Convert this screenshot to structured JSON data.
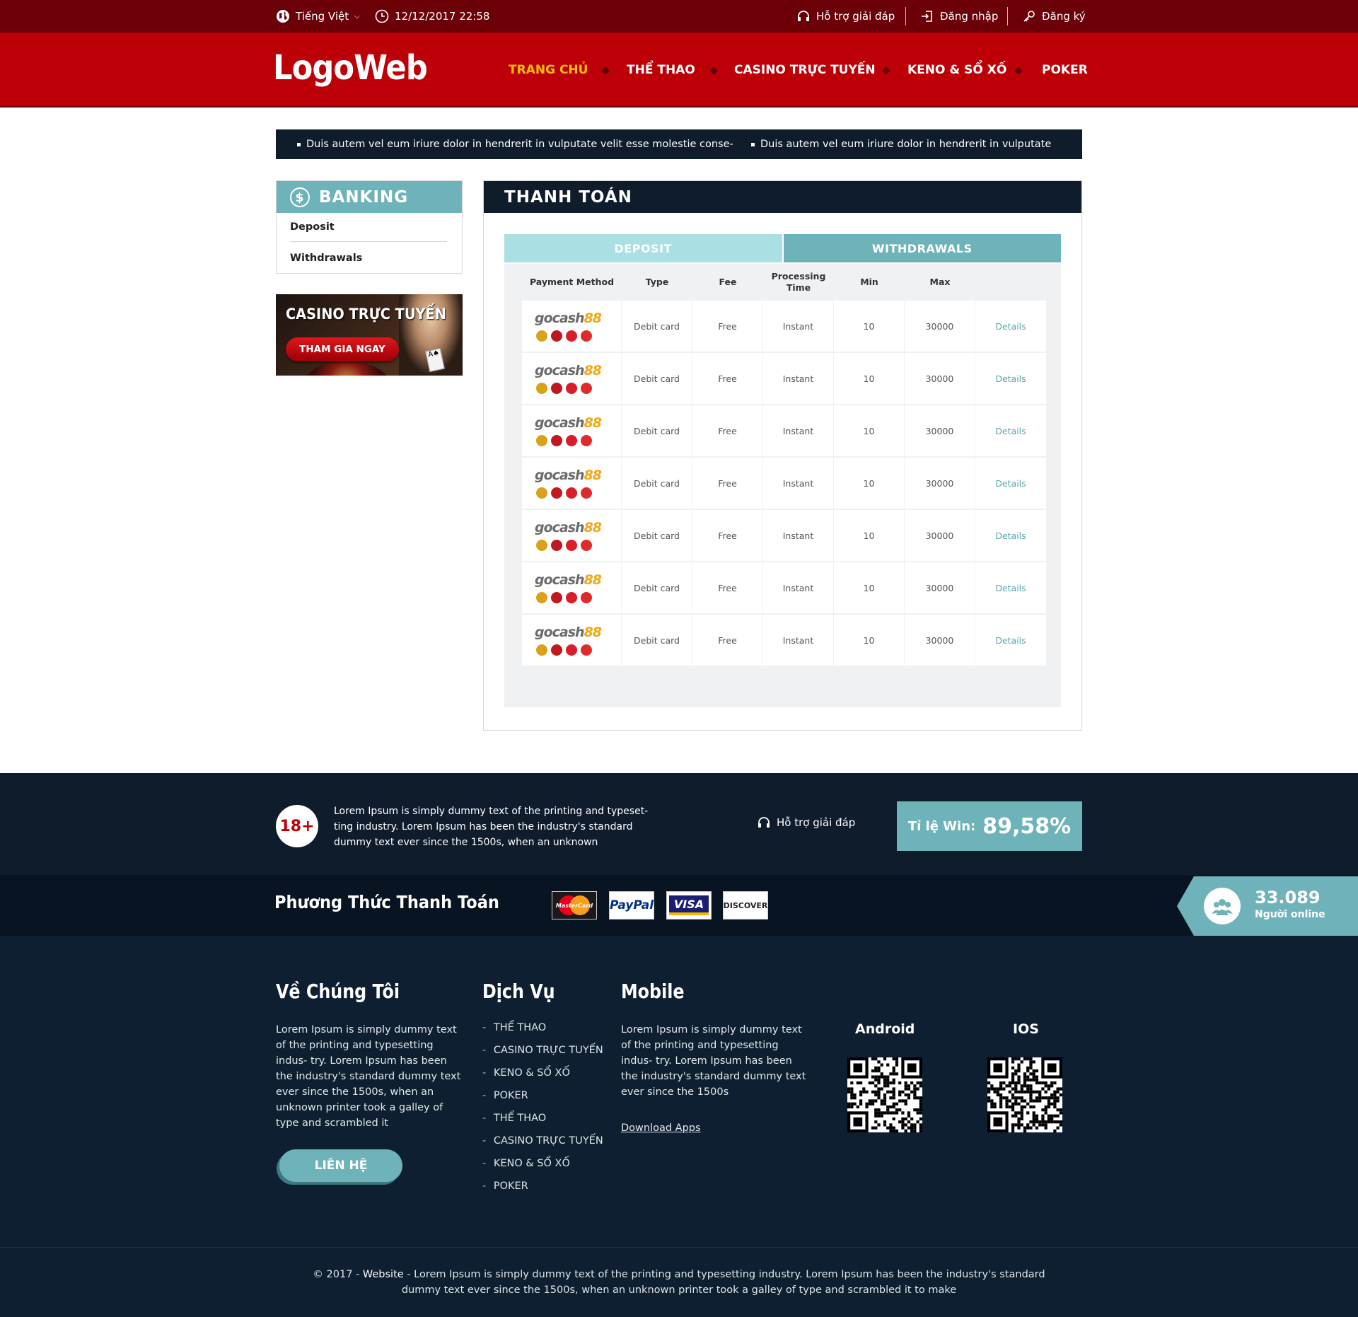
{
  "topbar": {
    "language": "Tiếng Việt",
    "datetime": "12/12/2017 22:58",
    "support": "Hỗ trợ giải đáp",
    "login": "Đăng nhập",
    "register": "Đăng ký"
  },
  "header": {
    "logo": "LogoWeb",
    "nav": [
      "TRANG CHỦ",
      "THỂ THAO",
      "CASINO TRỰC TUYẾN",
      "KENO & SỔ XỐ",
      "POKER"
    ]
  },
  "ticker": [
    "Duis autem vel eum iriure dolor in hendrerit in vulputate velit esse molestie conse-",
    "Duis autem vel eum iriure dolor in hendrerit in vulputate"
  ],
  "sidebar": {
    "title": "BANKING",
    "items": [
      "Deposit",
      "Withdrawals"
    ],
    "banner_title": "CASINO TRỰC TUYẾN",
    "banner_button": "THAM GIA NGAY"
  },
  "main": {
    "title": "THANH TOÁN",
    "tabs": [
      "DEPOSIT",
      "WITHDRAWALS"
    ],
    "columns": [
      "Payment Method",
      "Type",
      "Fee",
      "Processing Time",
      "Min",
      "Max"
    ],
    "rows": [
      {
        "method": "gocash88",
        "type": "Debit card",
        "fee": "Free",
        "time": "Instant",
        "min": "10",
        "max": "30000",
        "action": "Details"
      },
      {
        "method": "gocash88",
        "type": "Debit card",
        "fee": "Free",
        "time": "Instant",
        "min": "10",
        "max": "30000",
        "action": "Details"
      },
      {
        "method": "gocash88",
        "type": "Debit card",
        "fee": "Free",
        "time": "Instant",
        "min": "10",
        "max": "30000",
        "action": "Details"
      },
      {
        "method": "gocash88",
        "type": "Debit card",
        "fee": "Free",
        "time": "Instant",
        "min": "10",
        "max": "30000",
        "action": "Details"
      },
      {
        "method": "gocash88",
        "type": "Debit card",
        "fee": "Free",
        "time": "Instant",
        "min": "10",
        "max": "30000",
        "action": "Details"
      },
      {
        "method": "gocash88",
        "type": "Debit card",
        "fee": "Free",
        "time": "Instant",
        "min": "10",
        "max": "30000",
        "action": "Details"
      },
      {
        "method": "gocash88",
        "type": "Debit card",
        "fee": "Free",
        "time": "Instant",
        "min": "10",
        "max": "30000",
        "action": "Details"
      }
    ]
  },
  "footer_top": {
    "age": "18+",
    "text": "Lorem Ipsum is simply dummy text of the printing and typeset- ting industry. Lorem Ipsum has been the industry's standard dummy text ever since the 1500s, when an unknown",
    "support": "Hỗ trợ giải đáp",
    "win_label": "Tỉ lệ Win:",
    "win_value": "89,58%"
  },
  "payments": {
    "title": "Phương Thức Thanh Toán",
    "logos": [
      "MasterCard",
      "PayPal",
      "VISA",
      "DISCOVER"
    ],
    "online_count": "33.089",
    "online_label": "Người online"
  },
  "footer": {
    "about_title": "Về Chúng Tôi",
    "about_text": "Lorem Ipsum is simply dummy text of the printing and typesetting indus- try. Lorem Ipsum has been the industry's standard dummy text ever since the 1500s, when an unknown printer took a galley of type and scrambled it",
    "contact_button": "LIÊN HỆ",
    "services_title": "Dịch Vụ",
    "services": [
      "THỂ THAO",
      "CASINO TRỰC TUYẾN",
      "KENO & SỔ XỐ",
      "POKER",
      "THỂ THAO",
      "CASINO TRỰC TUYẾN",
      "KENO & SỔ XỐ",
      "POKER"
    ],
    "mobile_title": "Mobile",
    "mobile_text": "Lorem Ipsum is simply dummy text of the printing and typesetting indus- try. Lorem Ipsum has been the industry's standard dummy text ever since the 1500s",
    "download": "Download Apps",
    "android": "Android",
    "ios": "IOS",
    "copyright_prefix": "© 2017 - ",
    "copyright_site": "Website",
    "copyright_text": " - Lorem Ipsum is simply dummy text of the printing and typesetting industry. Lorem Ipsum has been the industry's standard dummy text ever since the 1500s, when an unknown printer took a galley of type and scrambled it to make"
  },
  "colors": {
    "brand_red": "#bd0007",
    "topbar_red": "#6b0008",
    "navy": "#0e1c2c",
    "teal": "#6fb3ba",
    "teal_light": "#aadfe3",
    "active_nav": "#ffc107"
  }
}
